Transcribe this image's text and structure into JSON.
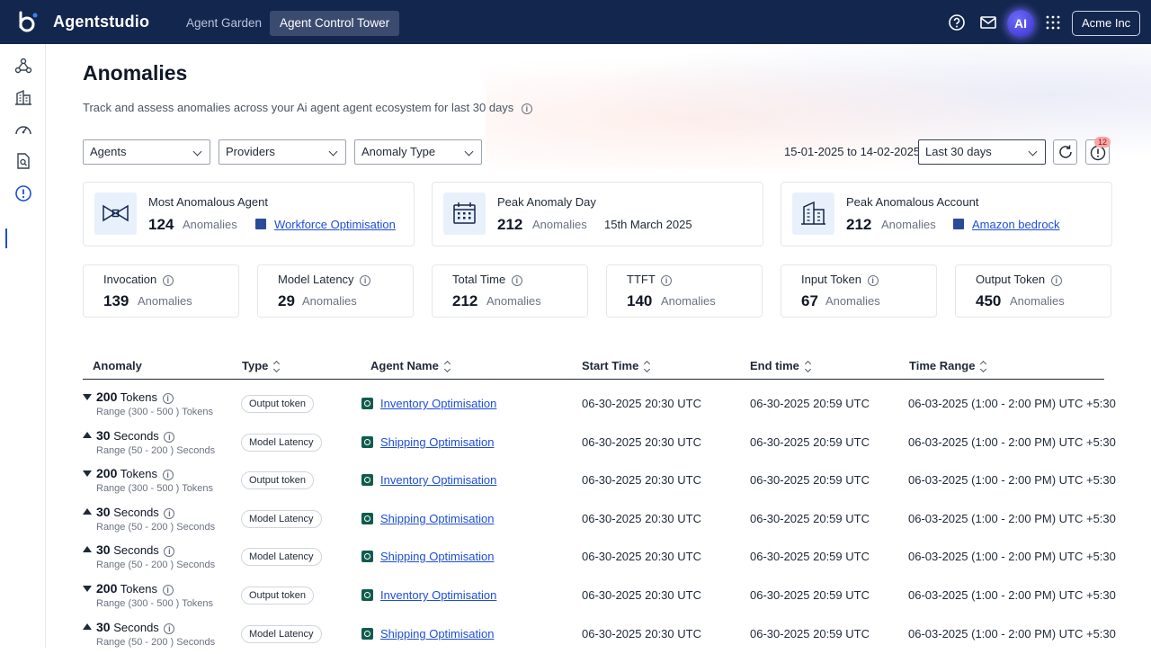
{
  "app": {
    "brand": "Agentstudio",
    "nav_tabs": [
      {
        "label": "Agent Garden",
        "active": false
      },
      {
        "label": "Agent Control Tower",
        "active": true
      }
    ],
    "ai_badge": "AI",
    "org": "Acme Inc",
    "topbar_color": "#13264e"
  },
  "sidebar": {
    "icons": [
      "workflow-icon",
      "building-icon",
      "dashboard-gauge-icon",
      "document-search-icon",
      "anomaly-alert-icon"
    ],
    "active": "anomaly-alert-icon"
  },
  "page": {
    "title": "Anomalies",
    "subtitle": "Track and assess anomalies across your Ai agent agent ecosystem for last 30 days"
  },
  "filters": {
    "agents": "Agents",
    "providers": "Providers",
    "anomaly_type": "Anomaly Type",
    "date_range": "15-01-2025 to 14-02-2025",
    "period": "Last 30 days",
    "notification_count": "12"
  },
  "summary_cards": [
    {
      "title": "Most Anomalous Agent",
      "value": "124",
      "unit": "Anomalies",
      "link": "Workforce Optimisation",
      "icon": "agent-bowtie-icon"
    },
    {
      "title": "Peak Anomaly Day",
      "value": "212",
      "unit": "Anomalies",
      "extra": "15th March 2025",
      "icon": "calendar-icon"
    },
    {
      "title": "Peak Anomalous Account",
      "value": "212",
      "unit": "Anomalies",
      "link": "Amazon bedrock",
      "icon": "building-icon"
    }
  ],
  "metric_cards": [
    {
      "title": "Invocation",
      "value": "139",
      "unit": "Anomalies"
    },
    {
      "title": "Model Latency",
      "value": "29",
      "unit": "Anomalies"
    },
    {
      "title": "Total Time",
      "value": "212",
      "unit": "Anomalies"
    },
    {
      "title": "TTFT",
      "value": "140",
      "unit": "Anomalies"
    },
    {
      "title": "Input Token",
      "value": "67",
      "unit": "Anomalies"
    },
    {
      "title": "Output Token",
      "value": "450",
      "unit": "Anomalies"
    }
  ],
  "table": {
    "headers": [
      "Anomaly",
      "Type",
      "Agent Name",
      "Start Time",
      "End time",
      "Time Range"
    ],
    "rows": [
      {
        "direction": "down",
        "value": "200",
        "unit": "Tokens",
        "range": "Range (300 - 500 ) Tokens",
        "type": "Output token",
        "agent": "Inventory Optimisation",
        "start": "06-30-2025 20:30  UTC",
        "end": "06-30-2025 20:59 UTC",
        "time_range": "06-03-2025  (1:00 - 2:00 PM) UTC +5:30"
      },
      {
        "direction": "up",
        "value": "30",
        "unit": "Seconds",
        "range": "Range (50 - 200 ) Seconds",
        "type": "Model Latency",
        "agent": "Shipping Optimisation",
        "start": "06-30-2025 20:30  UTC",
        "end": "06-30-2025 20:59 UTC",
        "time_range": "06-03-2025  (1:00 - 2:00 PM) UTC +5:30"
      },
      {
        "direction": "down",
        "value": "200",
        "unit": "Tokens",
        "range": "Range (300 - 500 ) Tokens",
        "type": "Output token",
        "agent": "Inventory Optimisation",
        "start": "06-30-2025 20:30  UTC",
        "end": "06-30-2025 20:59 UTC",
        "time_range": "06-03-2025  (1:00 - 2:00 PM) UTC +5:30"
      },
      {
        "direction": "up",
        "value": "30",
        "unit": "Seconds",
        "range": "Range (50 - 200 ) Seconds",
        "type": "Model Latency",
        "agent": "Shipping Optimisation",
        "start": "06-30-2025 20:30  UTC",
        "end": "06-30-2025 20:59 UTC",
        "time_range": "06-03-2025  (1:00 - 2:00 PM) UTC +5:30"
      },
      {
        "direction": "up",
        "value": "30",
        "unit": "Seconds",
        "range": "Range (50 - 200 ) Seconds",
        "type": "Model Latency",
        "agent": "Shipping Optimisation",
        "start": "06-30-2025 20:30  UTC",
        "end": "06-30-2025 20:59 UTC",
        "time_range": "06-03-2025  (1:00 - 2:00 PM) UTC +5:30"
      },
      {
        "direction": "down",
        "value": "200",
        "unit": "Tokens",
        "range": "Range (300 - 500 ) Tokens",
        "type": "Output token",
        "agent": "Inventory Optimisation",
        "start": "06-30-2025 20:30  UTC",
        "end": "06-30-2025 20:59 UTC",
        "time_range": "06-03-2025  (1:00 - 2:00 PM) UTC +5:30"
      },
      {
        "direction": "up",
        "value": "30",
        "unit": "Seconds",
        "range": "Range (50 - 200 ) Seconds",
        "type": "Model Latency",
        "agent": "Shipping Optimisation",
        "start": "06-30-2025 20:30  UTC",
        "end": "06-30-2025 20:59 UTC",
        "time_range": "06-03-2025  (1:00 - 2:00 PM) UTC +5:30"
      }
    ]
  }
}
